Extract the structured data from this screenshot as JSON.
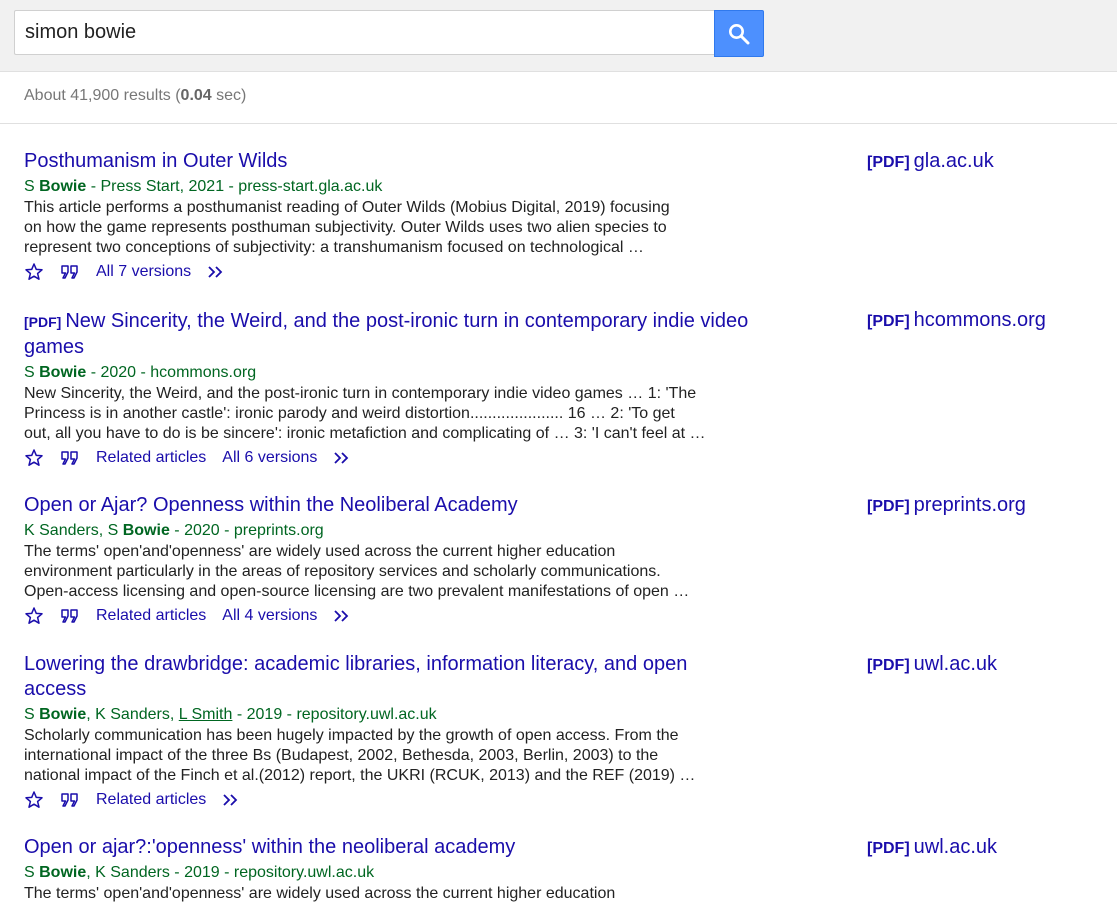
{
  "search": {
    "query": "simon bowie",
    "button_icon": "search-icon",
    "accent": "#4d90fe"
  },
  "stats": {
    "prefix": "About 41,900 results (",
    "time": "0.04",
    "suffix": " sec)"
  },
  "results": [
    {
      "tag": "",
      "title": "Posthumanism in Outer Wilds",
      "authors_html_parts": [
        "S ",
        "Bowie",
        " - Press Start, 2021 - press-start.gla.ac.uk"
      ],
      "snippet": "This article performs a posthumanist reading of Outer Wilds (Mobius Digital, 2019) focusing\non how the game represents posthuman subjectivity. Outer Wilds uses two alien species to\nrepresent two conceptions of subjectivity: a transhumanism focused on technological …",
      "related": "",
      "versions": "All 7 versions",
      "side_tag": "[PDF]",
      "side_domain": "gla.ac.uk"
    },
    {
      "tag": "[PDF]",
      "title": "New Sincerity, the Weird, and the post-ironic turn in contemporary indie video games",
      "authors_html_parts": [
        "S ",
        "Bowie",
        " - 2020 - hcommons.org"
      ],
      "snippet": "New Sincerity, the Weird, and the post-ironic turn in contemporary indie video games … 1: 'The\nPrincess is in another castle': ironic parody and weird distortion..................... 16 … 2: 'To get\nout, all you have to do is be sincere': ironic metafiction and complicating of … 3: 'I can't feel at …",
      "related": "Related articles",
      "versions": "All 6 versions",
      "side_tag": "[PDF]",
      "side_domain": "hcommons.org"
    },
    {
      "tag": "",
      "title": "Open or Ajar? Openness within the Neoliberal Academy",
      "authors_html_parts": [
        "K Sanders, S ",
        "Bowie",
        " - 2020 - preprints.org"
      ],
      "snippet": "The terms' open'and'openness' are widely used across the current higher education\nenvironment particularly in the areas of repository services and scholarly communications.\nOpen-access licensing and open-source licensing are two prevalent manifestations of open …",
      "related": "Related articles",
      "versions": "All 4 versions",
      "side_tag": "[PDF]",
      "side_domain": "preprints.org"
    },
    {
      "tag": "",
      "title": "Lowering the drawbridge: academic libraries, information literacy, and open access",
      "authors_html_parts": [
        "S ",
        "Bowie",
        ", K Sanders, ",
        "L Smith",
        " - 2019 - repository.uwl.ac.uk"
      ],
      "snippet": "Scholarly communication has been hugely impacted by the growth of open access. From the\ninternational impact of the three Bs (Budapest, 2002, Bethesda, 2003, Berlin, 2003) to the\nnational impact of the Finch et al.(2012) report, the UKRI (RCUK, 2013) and the REF (2019) …",
      "related": "Related articles",
      "versions": "",
      "side_tag": "[PDF]",
      "side_domain": "uwl.ac.uk"
    },
    {
      "tag": "",
      "title": "Open or ajar?:'openness' within the neoliberal academy",
      "authors_html_parts": [
        "S ",
        "Bowie",
        ", K Sanders - 2019 - repository.uwl.ac.uk"
      ],
      "snippet": "The terms' open'and'openness' are widely used across the current higher education",
      "related": "",
      "versions": "",
      "side_tag": "[PDF]",
      "side_domain": "uwl.ac.uk"
    }
  ],
  "icons": {
    "save": "star-icon",
    "cite": "quote-icon",
    "more": "double-chevron-icon"
  }
}
